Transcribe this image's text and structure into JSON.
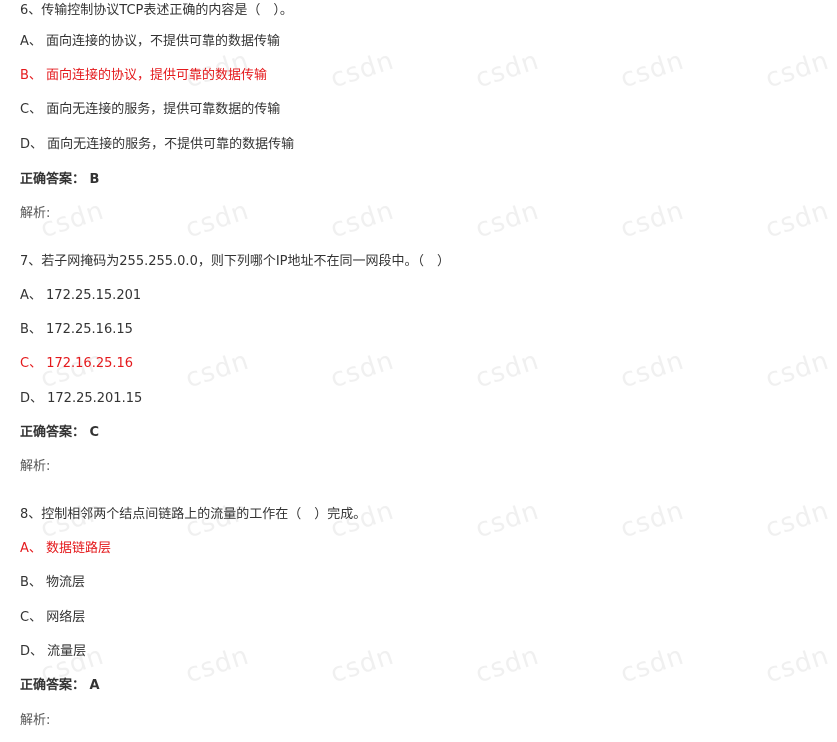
{
  "questions": [
    {
      "stem": "6、传输控制协议TCP表述正确的内容是（　）。",
      "options": [
        "A、 面向连接的协议，不提供可靠的数据传输",
        "B、 面向连接的协议，提供可靠的数据传输",
        "C、 面向无连接的服务，提供可靠数据的传输",
        "D、 面向无连接的服务，不提供可靠的数据传输"
      ],
      "correct_index": 1,
      "answer_text": "正确答案： B",
      "analysis_text": "解析:"
    },
    {
      "stem": "7、若子网掩码为255.255.0.0，则下列哪个IP地址不在同一网段中。（　）",
      "options": [
        "A、 172.25.15.201",
        "B、 172.25.16.15",
        "C、 172.16.25.16",
        "D、 172.25.201.15"
      ],
      "correct_index": 2,
      "answer_text": "正确答案： C",
      "analysis_text": "解析:"
    },
    {
      "stem": "8、控制相邻两个结点间链路上的流量的工作在（　）完成。",
      "options": [
        "A、 数据链路层",
        "B、 物流层",
        "C、 网络层",
        "D、 流量层"
      ],
      "correct_index": 0,
      "answer_text": "正确答案： A",
      "analysis_text": "解析:"
    }
  ],
  "colors": {
    "correct_option": "#e4191c",
    "text": "#333333",
    "watermark": "#c8c8c8"
  }
}
